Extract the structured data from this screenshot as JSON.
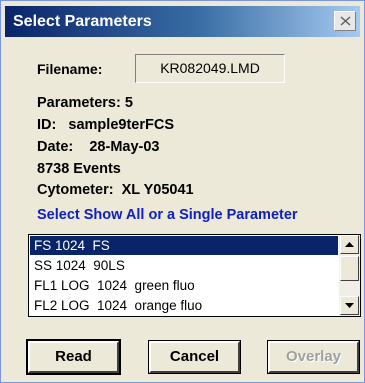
{
  "window": {
    "title": "Select Parameters",
    "close_icon": "close-icon"
  },
  "file": {
    "filename_label": "Filename:",
    "filename_value": "KR082049.LMD"
  },
  "info": {
    "parameters": "Parameters: 5",
    "id": "ID:   sample9terFCS",
    "date": "Date:    28-May-03",
    "events": "8738 Events",
    "cytometer": "Cytometer:  XL Y05041"
  },
  "prompt": "Select Show All or a Single Parameter",
  "parameters_list": {
    "items": [
      {
        "label": "FS 1024  FS",
        "selected": true
      },
      {
        "label": "SS 1024  90LS",
        "selected": false
      },
      {
        "label": "FL1 LOG  1024  green fluo",
        "selected": false
      },
      {
        "label": "FL2 LOG  1024  orange fluo",
        "selected": false
      }
    ],
    "scroll_up_icon": "arrow-up-icon",
    "scroll_down_icon": "arrow-down-icon"
  },
  "buttons": {
    "read": "Read",
    "cancel": "Cancel",
    "overlay": "Overlay"
  },
  "colors": {
    "selection": "#0a246a",
    "prompt_text": "#1020c0",
    "title_gradient_start": "#0a246a",
    "title_gradient_end": "#a6caf0"
  }
}
